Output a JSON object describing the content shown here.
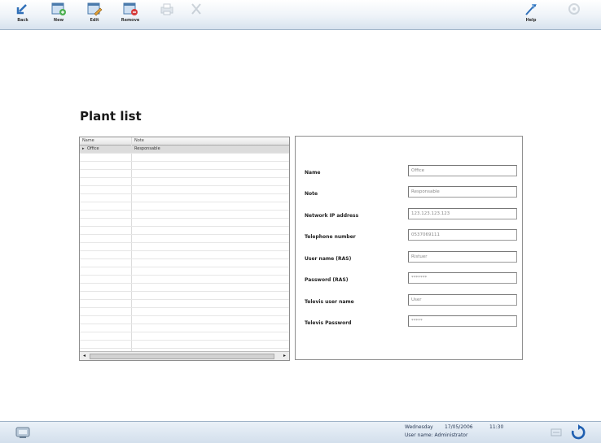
{
  "toolbar": {
    "back_label": "Back",
    "new_label": "New",
    "edit_label": "Edit",
    "remove_label": "Remove",
    "help_label": "Help"
  },
  "page": {
    "title": "Plant list"
  },
  "plant_list": {
    "columns": [
      "Name",
      "Note"
    ],
    "rows": [
      {
        "name": "Office",
        "note": "Responsable"
      }
    ]
  },
  "details": {
    "fields": [
      {
        "label": "Name",
        "value": "Office"
      },
      {
        "label": "Note",
        "value": "Responsable"
      },
      {
        "label": "Network IP address",
        "value": "123.123.123.123"
      },
      {
        "label": "Telephone number",
        "value": "0537069111"
      },
      {
        "label": "User name (RAS)",
        "value": "Ristuer"
      },
      {
        "label": "Password (RAS)",
        "value": "*******"
      },
      {
        "label": "Televis user name",
        "value": "User"
      },
      {
        "label": "Televis Password",
        "value": "*****"
      }
    ]
  },
  "status": {
    "day": "Wednesday",
    "date": "17/05/2006",
    "time": "11:30",
    "user": "User name: Administrator"
  },
  "colors": {
    "accent": "#2f6fb8",
    "toolbar_bg": "#e6eef6"
  },
  "icons": [
    "back-icon",
    "new-icon",
    "edit-icon",
    "remove-icon",
    "print-icon",
    "close-icon",
    "help-icon",
    "settings-icon",
    "system-icon",
    "network-icon",
    "refresh-icon"
  ]
}
